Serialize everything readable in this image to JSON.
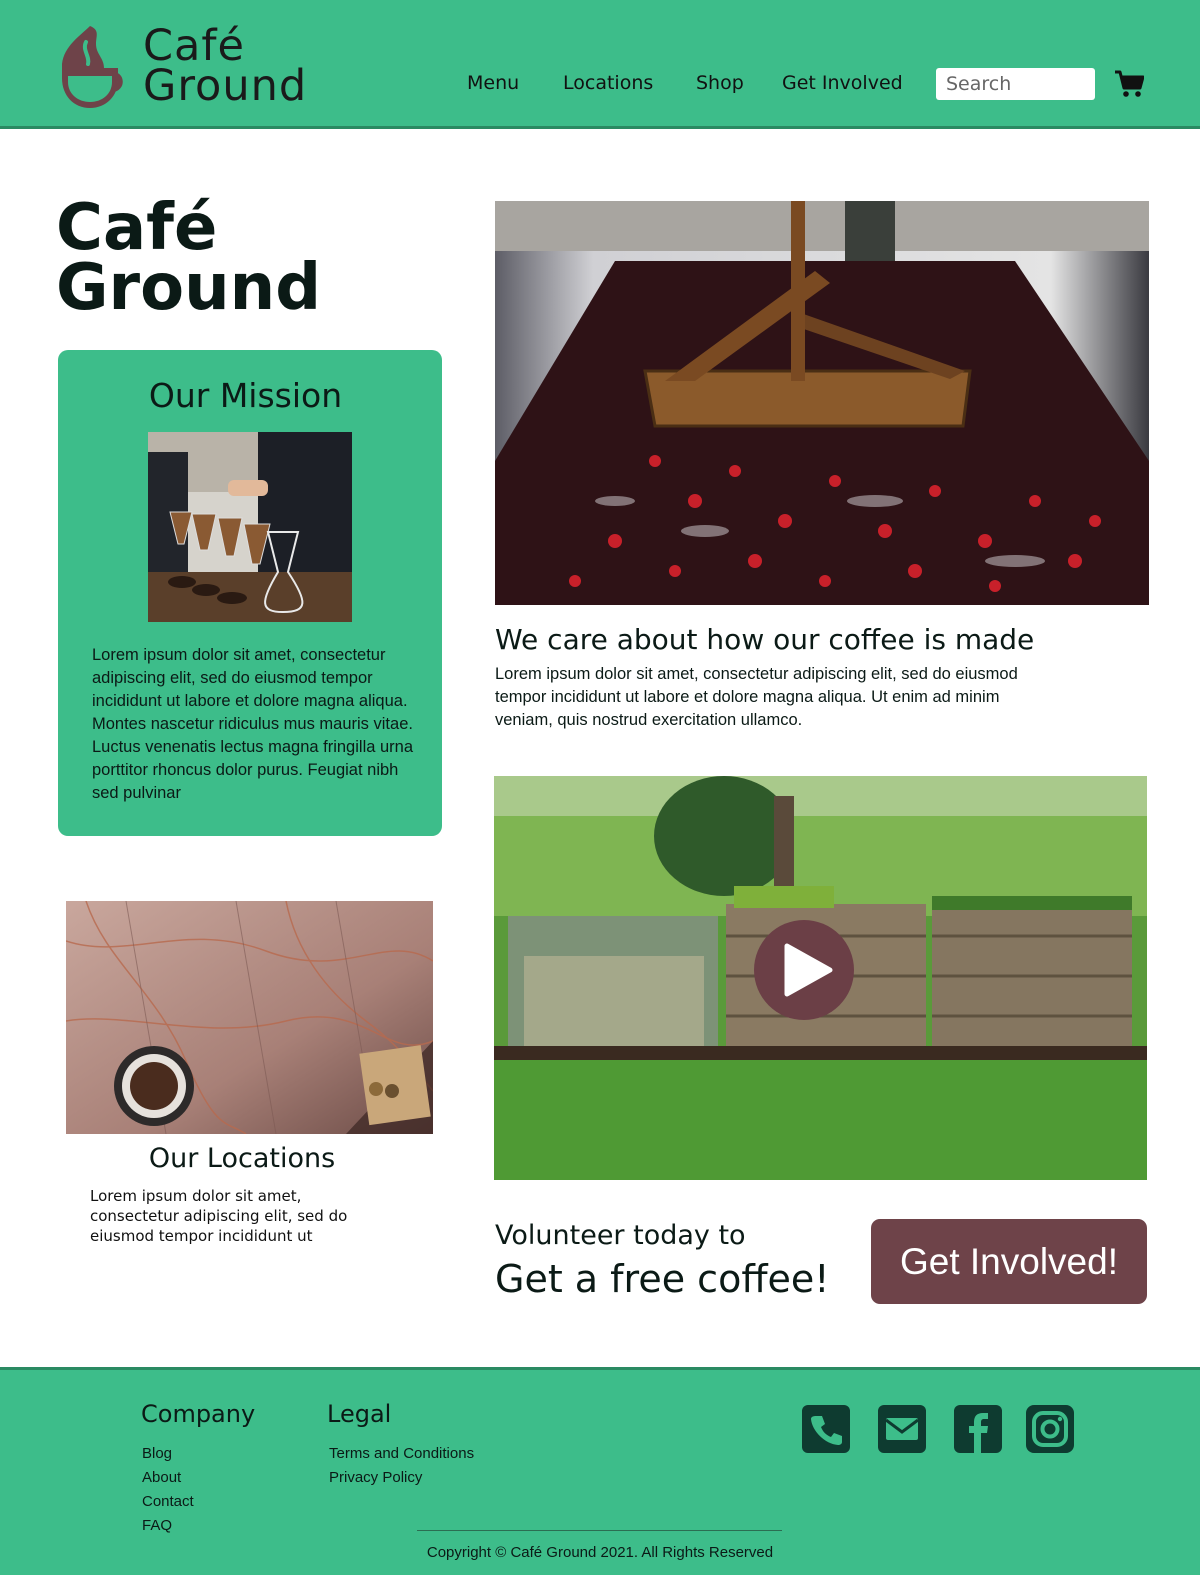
{
  "brand": {
    "name_line1": "Café",
    "name_line2": "Ground",
    "accent_color": "#3dbd8a",
    "logo_color": "#6e4349"
  },
  "nav": {
    "items": [
      {
        "label": "Menu"
      },
      {
        "label": "Locations"
      },
      {
        "label": "Shop"
      },
      {
        "label": "Get Involved"
      }
    ],
    "search_placeholder": "Search",
    "cart_icon": "shopping-cart-icon"
  },
  "hero": {
    "title_line1": "Café",
    "title_line2": "Ground"
  },
  "mission": {
    "title": "Our Mission",
    "text": "Lorem ipsum dolor sit amet, consectetur adipiscing elit, sed do eiusmod tempor incididunt ut labore et dolore magna aliqua. Montes nascetur ridiculus mus mauris vitae. Luctus venenatis lectus magna fringilla urna porttitor rhoncus dolor purus. Feugiat nibh sed pulvinar"
  },
  "care": {
    "title": "We care about how our coffee is made",
    "text": "Lorem ipsum dolor sit amet, consectetur adipiscing elit, sed do eiusmod tempor incididunt ut labore et dolore magna aliqua. Ut enim ad minim veniam, quis nostrud exercitation ullamco."
  },
  "locations": {
    "title": "Our Locations",
    "text": "Lorem ipsum dolor sit amet, consectetur adipiscing elit, sed do eiusmod tempor incididunt ut"
  },
  "volunteer": {
    "line1": "Volunteer today to",
    "line2": "Get a free coffee!",
    "button": "Get Involved!",
    "button_color": "#6e4349"
  },
  "footer": {
    "company": {
      "heading": "Company",
      "links": [
        "Blog",
        "About",
        "Contact",
        "FAQ"
      ]
    },
    "legal": {
      "heading": "Legal",
      "links": [
        "Terms and Conditions",
        "Privacy Policy"
      ]
    },
    "social_icons": [
      "phone-icon",
      "email-icon",
      "facebook-icon",
      "instagram-icon"
    ],
    "copyright": "Copyright © Café Ground 2021. All Rights Reserved"
  }
}
